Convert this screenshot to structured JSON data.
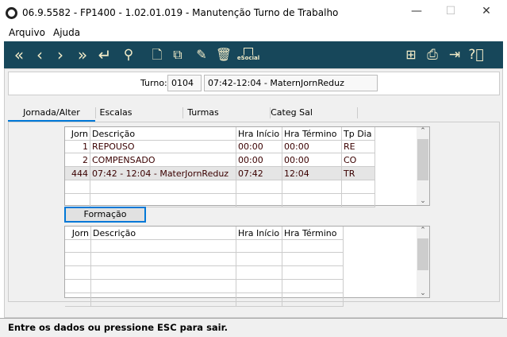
{
  "window": {
    "title": "06.9.5582 - FP1400 - 1.02.01.019 - Manutenção Turno de Trabalho",
    "minimize": "—",
    "maximize": "☐",
    "close": "✕"
  },
  "menu": [
    "Arquivo",
    "Ajuda"
  ],
  "toolbar": {
    "icons": [
      "first-icon",
      "previous-icon",
      "next-icon",
      "last-icon",
      "enter-icon",
      "search-icon",
      "new-icon",
      "copy-icon",
      "edit-icon",
      "delete-icon",
      "esocial-icon",
      "tree-icon",
      "print-icon",
      "exit-icon",
      "help-icon"
    ],
    "esocial_label": "eSocial",
    "bg": "#17475a"
  },
  "turno": {
    "label": "Turno:",
    "code": "0104",
    "description": "07:42-12:04 - MaternJornReduz"
  },
  "tabs": [
    "Jornada/Alter",
    "Escalas",
    "Turmas",
    "Categ Sal"
  ],
  "grid1": {
    "columns": [
      "Jorn",
      "Descrição",
      "Hra Início",
      "Hra Término",
      "Tp Dia"
    ],
    "rows": [
      [
        "1",
        "REPOUSO",
        "00:00",
        "00:00",
        "RE"
      ],
      [
        "2",
        "COMPENSADO",
        "00:00",
        "00:00",
        "CO"
      ],
      [
        "444",
        "07:42 - 12:04 - MaterJornReduz",
        "07:42",
        "12:04",
        "TR"
      ]
    ],
    "selected_row": 2
  },
  "formacao_button": "Formação",
  "grid2": {
    "columns": [
      "Jorn",
      "Descrição",
      "Hra Início",
      "Hra Término"
    ]
  },
  "status": "Entre os dados ou pressione ESC para sair."
}
